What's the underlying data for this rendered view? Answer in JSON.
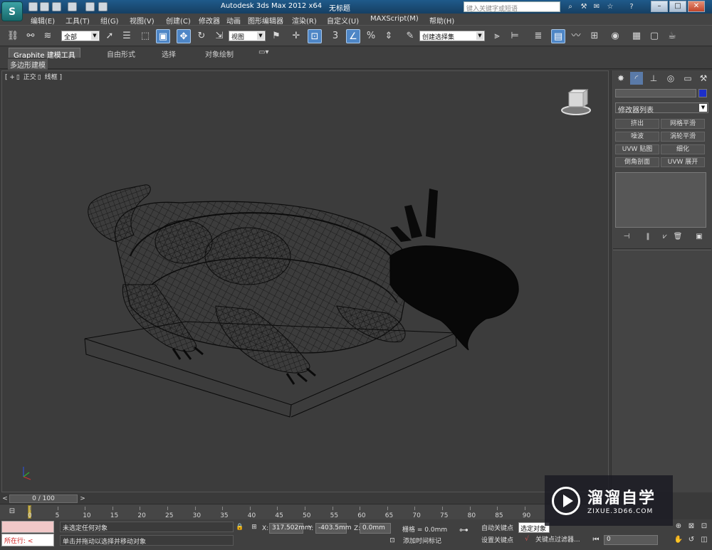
{
  "titlebar": {
    "app_logo_text": "S",
    "title": "Autodesk 3ds Max  2012 x64",
    "file": "无标题",
    "search_placeholder": "键入关键字或短语",
    "help_label": "?"
  },
  "menu": {
    "items": [
      "编辑(E)",
      "工具(T)",
      "组(G)",
      "视图(V)",
      "创建(C)",
      "修改器",
      "动画",
      "图形编辑器",
      "渲染(R)",
      "自定义(U)",
      "MAXScript(M)",
      "帮助(H)"
    ]
  },
  "toolbar": {
    "filter_value": "全部",
    "refcoord_value": "视图",
    "named_sel_value": "创建选择集",
    "snap_label": "3"
  },
  "ribbon": {
    "tabs": [
      "Graphite 建模工具",
      "自由形式",
      "选择",
      "对象绘制"
    ],
    "sub_label": "多边形建模"
  },
  "viewport": {
    "label_plus": "[ +",
    "label_view": "正交",
    "label_shade": "线框 ]"
  },
  "command_panel": {
    "modifier_list": "修改器列表",
    "modifier_buttons": [
      "挤出",
      "网格平滑",
      "噪波",
      "涡轮平滑",
      "UVW 贴图",
      "细化",
      "倒角剖面",
      "UVW 展开"
    ],
    "color": "#1d2fc9"
  },
  "timeslider": {
    "frame_label": "0 / 100"
  },
  "trackbar": {
    "ticks": [
      "0",
      "5",
      "10",
      "15",
      "20",
      "25",
      "30",
      "35",
      "40",
      "45",
      "50",
      "55",
      "60",
      "65",
      "70",
      "75",
      "80",
      "85",
      "90"
    ]
  },
  "statusbar": {
    "running_label": "所在行:",
    "status_top": "未选定任何对象",
    "status_bottom": "单击并拖动以选择并移动对象",
    "x_label": "X:",
    "x_value": "317.502mm",
    "y_label": "Y:",
    "y_value": "-403.5mm",
    "z_label": "Z:",
    "z_value": "0.0mm",
    "grid": "栅格 = 0.0mm",
    "add_time_tag": "添加时间标记",
    "auto_key": "自动关键点",
    "set_key": "设置关键点",
    "selected_dd": "选定对象",
    "key_filters": "关键点过滤器...",
    "frame_value": "0"
  },
  "watermark": {
    "brand_cn": "溜溜自学",
    "url": "ZIXUE.3D66.COM"
  }
}
